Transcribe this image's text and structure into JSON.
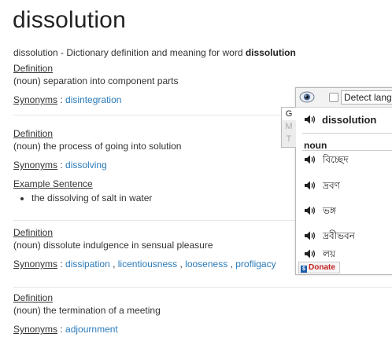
{
  "page": {
    "title": "dissolution",
    "subtitle_prefix": "dissolution - Dictionary definition and meaning for word ",
    "subtitle_word": "dissolution"
  },
  "labels": {
    "definition": "Definition",
    "synonyms": "Synonyms",
    "synonyms_sep": " : ",
    "example": "Example Sentence"
  },
  "entries": [
    {
      "definition": "(noun) separation into component parts",
      "synonyms": [
        "disintegration"
      ]
    },
    {
      "definition": "(noun) the process of going into solution",
      "synonyms": [
        "dissolving"
      ],
      "example": "the dissolving of salt in water"
    },
    {
      "definition": "(noun) dissolute indulgence in sensual pleasure",
      "synonyms": [
        "dissipation",
        "licentiousness",
        "looseness",
        "profligacy"
      ]
    },
    {
      "definition": "(noun) the termination of a meeting",
      "synonyms": [
        "adjournment"
      ]
    }
  ],
  "popup": {
    "detect_label": "Detect language",
    "tabs": [
      "G",
      "M",
      "T"
    ],
    "word": "dissolution",
    "pos": "noun",
    "translations": [
      "বিচ্ছেদ",
      "দ্রবণ",
      "ভঙ্গ",
      "দ্রবীভবন",
      "লয়"
    ],
    "donate": "Donate",
    "donate_badge": "$"
  },
  "colors": {
    "link": "#2a7ab9",
    "text": "#333333",
    "donate": "#c41e1e"
  }
}
